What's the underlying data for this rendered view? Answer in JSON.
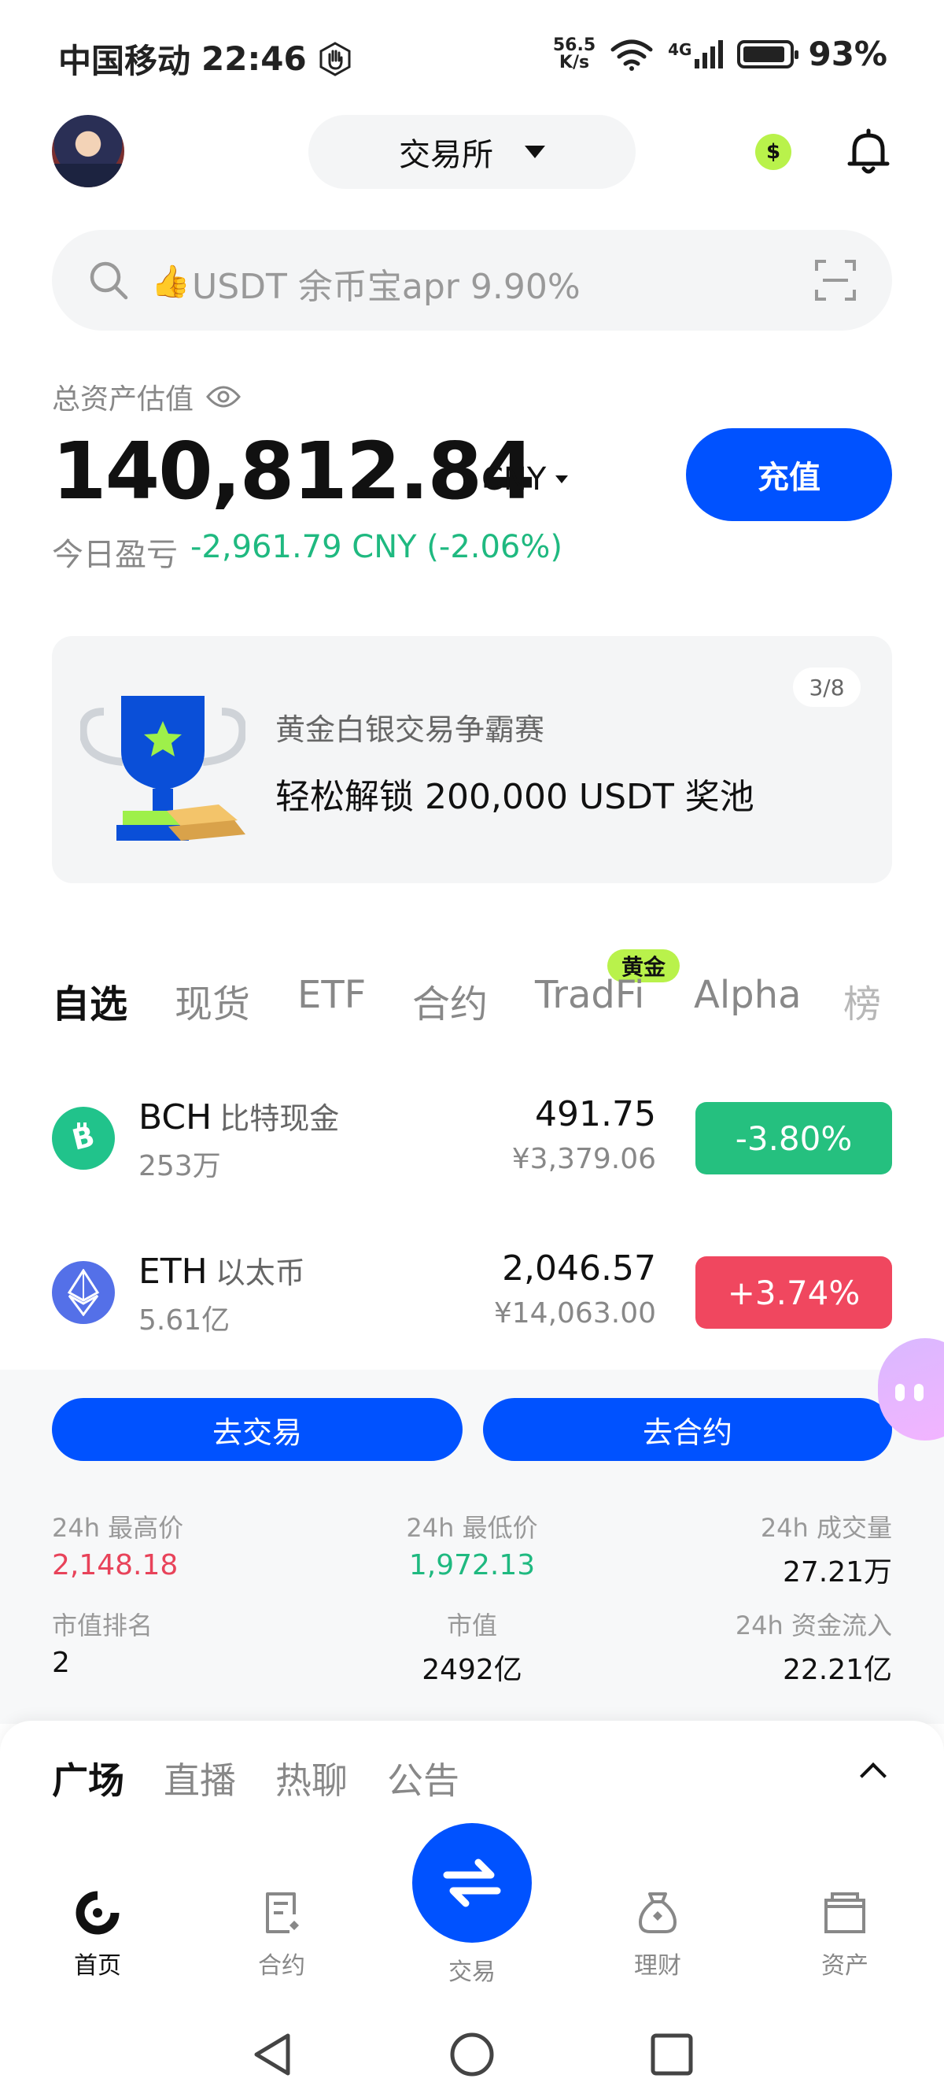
{
  "status_bar": {
    "carrier": "中国移动",
    "time": "22:46",
    "net_speed_value": "56.5",
    "net_speed_unit": "K/s",
    "network": "4G",
    "battery": "93%"
  },
  "header": {
    "exchange_label": "交易所"
  },
  "search": {
    "placeholder": "USDT 余币宝apr 9.90%"
  },
  "assets": {
    "label": "总资产估值",
    "total": "140,812.84",
    "currency": "CNY",
    "deposit_label": "充值",
    "pnl_label": "今日盈亏",
    "pnl_value": "-2,961.79 CNY (-2.06%)"
  },
  "banner": {
    "pager": "3/8",
    "subtitle": "黄金白银交易争霸赛",
    "title": "轻松解锁 200,000 USDT 奖池"
  },
  "market_tabs": [
    {
      "label": "自选"
    },
    {
      "label": "现货"
    },
    {
      "label": "ETF"
    },
    {
      "label": "合约"
    },
    {
      "label": "TradFi"
    },
    {
      "label": "Alpha"
    },
    {
      "label": "榜"
    }
  ],
  "tradfi_badge": "黄金",
  "market_rows": [
    {
      "symbol": "BCH",
      "name_cn": "比特现金",
      "volume": "253万",
      "price": "491.75",
      "price_cny": "¥3,379.06",
      "change": "-3.80%",
      "direction": "down",
      "icon_color": "#21c38b"
    },
    {
      "symbol": "ETH",
      "name_cn": "以太币",
      "volume": "5.61亿",
      "price": "2,046.57",
      "price_cny": "¥14,063.00",
      "change": "+3.74%",
      "direction": "up",
      "icon_color": "#5470e8"
    }
  ],
  "detail": {
    "trade_button": "去交易",
    "futures_button": "去合约",
    "stats": {
      "high_label": "24h 最高价",
      "high_value": "2,148.18",
      "low_label": "24h 最低价",
      "low_value": "1,972.13",
      "volume_label": "24h 成交量",
      "volume_value": "27.21万",
      "rank_label": "市值排名",
      "rank_value": "2",
      "mcap_label": "市值",
      "mcap_value": "2492亿",
      "inflow_label": "24h 资金流入",
      "inflow_value": "22.21亿"
    }
  },
  "sheet": {
    "tabs": [
      "广场",
      "直播",
      "热聊",
      "公告"
    ]
  },
  "bottom_nav": {
    "home": "首页",
    "futures": "合约",
    "trade": "交易",
    "earn": "理财",
    "assets": "资产"
  },
  "colors": {
    "primary": "#0052ff",
    "green": "#25c07f",
    "red": "#f0475f",
    "lime": "#b9f24b"
  }
}
